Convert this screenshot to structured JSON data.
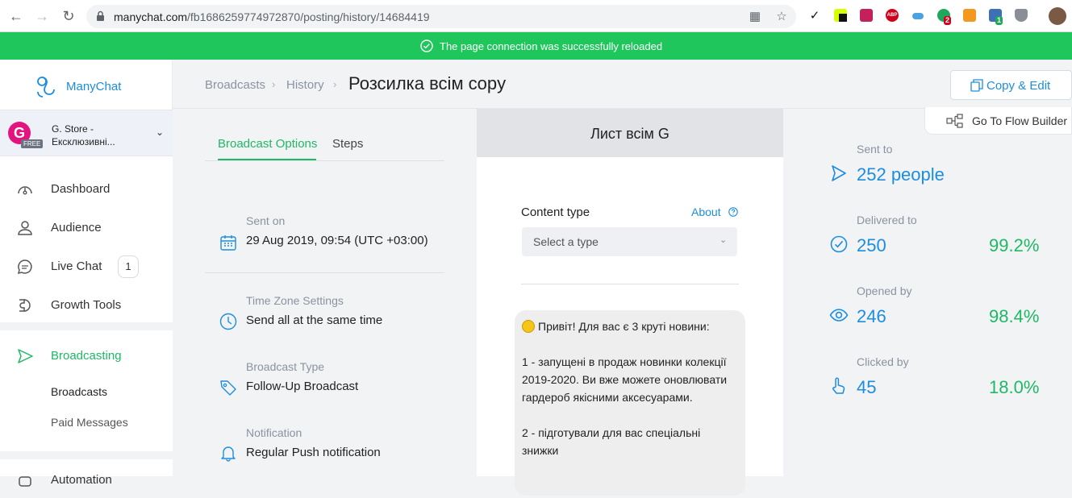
{
  "browser": {
    "url_domain": "manychat.com",
    "url_path": "/fb1686259774972870/posting/history/14684419"
  },
  "banner": {
    "message": "The page connection was successfully reloaded"
  },
  "sidebar": {
    "brand": "ManyChat",
    "account": {
      "initial": "G",
      "badge": "FREE",
      "name": "G. Store - Ексклюзивні..."
    },
    "items": [
      {
        "label": "Dashboard",
        "icon": "gauge-icon"
      },
      {
        "label": "Audience",
        "icon": "person-icon"
      },
      {
        "label": "Live Chat",
        "icon": "chat-bubble-icon",
        "badge": "1"
      },
      {
        "label": "Growth Tools",
        "icon": "magnet-icon"
      },
      {
        "label": "Broadcasting",
        "icon": "paper-plane-icon"
      },
      {
        "label": "Automation",
        "icon": "robot-icon"
      }
    ],
    "sub_items": [
      {
        "label": "Broadcasts"
      },
      {
        "label": "Paid Messages"
      }
    ]
  },
  "header": {
    "breadcrumbs": [
      "Broadcasts",
      "History"
    ],
    "title": "Розсилка всім copy",
    "copy_edit": "Copy & Edit",
    "flow_builder": "Go To Flow Builder"
  },
  "options": {
    "tabs": [
      "Broadcast Options",
      "Steps"
    ],
    "sent_on": {
      "label": "Sent on",
      "value": "29 Aug 2019, 09:54 (UTC +03:00)"
    },
    "timezone": {
      "label": "Time Zone Settings",
      "value": "Send all at the same time"
    },
    "type": {
      "label": "Broadcast Type",
      "value": "Follow-Up Broadcast"
    },
    "notification": {
      "label": "Notification",
      "value": "Regular Push notification"
    }
  },
  "preview": {
    "header": "Лист всім G",
    "content_type_label": "Content type",
    "about": "About",
    "select_placeholder": "Select a type",
    "message": "Привіт! Для вас є 3 круті новини:\n\n1 - запущені в продаж новинки колекції 2019-2020. Ви вже можете оновлювати гардероб якісними аксесуарами.\n\n2 - підготували для вас спеціальні знижки"
  },
  "stats": {
    "sent": {
      "label": "Sent to",
      "value": "252 people"
    },
    "delivered": {
      "label": "Delivered to",
      "value": "250",
      "pct": "99.2%"
    },
    "opened": {
      "label": "Opened by",
      "value": "246",
      "pct": "98.4%"
    },
    "clicked": {
      "label": "Clicked by",
      "value": "45",
      "pct": "18.0%"
    }
  },
  "colors": {
    "accent_blue": "#1c8ddf",
    "success_green": "#1fb865",
    "banner_green": "#1fc65c"
  }
}
